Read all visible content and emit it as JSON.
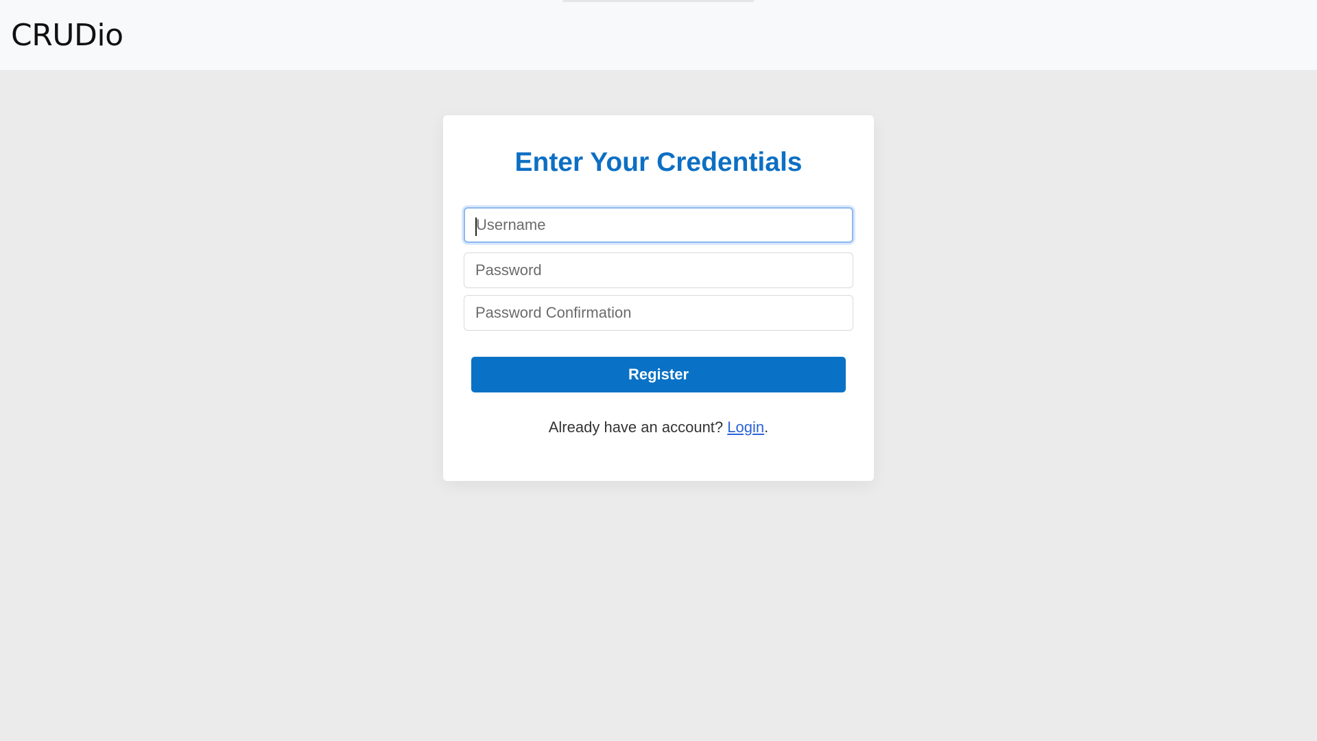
{
  "navbar": {
    "brand": "CRUDio"
  },
  "form": {
    "title": "Enter Your Credentials",
    "username_placeholder": "Username",
    "password_placeholder": "Password",
    "password_confirmation_placeholder": "Password Confirmation",
    "submit_label": "Register",
    "footer_text": "Already have an account?",
    "footer_link": "Login",
    "footer_punct": "."
  },
  "colors": {
    "accent": "#0a72c6",
    "title": "#0d6fc3",
    "link": "#2a62d6",
    "page_bg": "#ebebeb",
    "navbar_bg": "#f8f9fa"
  }
}
